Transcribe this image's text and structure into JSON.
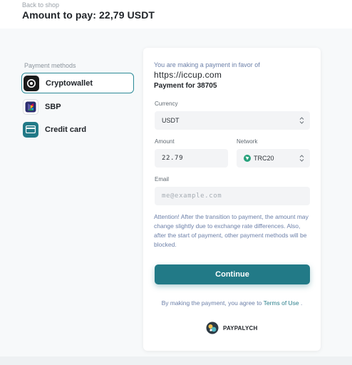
{
  "header": {
    "back_link": "Back to shop",
    "amount_title": "Amount to pay: 22,79 USDT"
  },
  "methods": {
    "label": "Payment methods",
    "items": [
      {
        "label": "Cryptowallet",
        "icon": "crypto-wallet-icon",
        "active": true
      },
      {
        "label": "SBP",
        "icon": "sbp-icon",
        "active": false
      },
      {
        "label": "Credit card",
        "icon": "credit-card-icon",
        "active": false
      }
    ]
  },
  "payment": {
    "favor_text": "You are making a payment in favor of",
    "site_url": "https://iccup.com",
    "payment_for": "Payment for 38705",
    "currency_label": "Currency",
    "currency_value": "USDT",
    "amount_label": "Amount",
    "amount_value": "22.79",
    "network_label": "Network",
    "network_value": "TRC20",
    "email_label": "Email",
    "email_placeholder": "me@example.com",
    "attention": "Attention! After the transition to payment, the amount may change slightly due to exchange rate differences. Also, after the start of payment, other payment methods will be blocked.",
    "continue_label": "Continue",
    "agree_prefix": "By making the payment, you agree to",
    "terms_link": "Terms of Use",
    "agree_suffix": ".",
    "brand_name": "PAYPALYCH"
  },
  "colors": {
    "accent": "#227a87",
    "accent_border": "#2c8a97",
    "muted_text": "#6b7fa8",
    "tron_green": "#26a17b"
  }
}
